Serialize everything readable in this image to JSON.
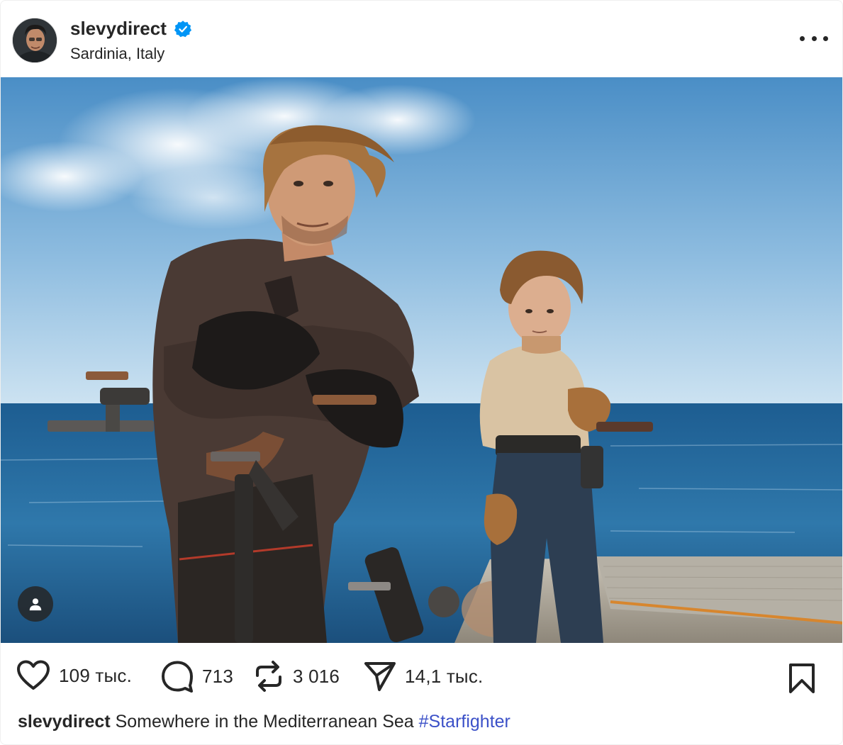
{
  "header": {
    "username": "slevydirect",
    "location": "Sardinia, Italy",
    "icons": {
      "verified": "verified-badge-icon",
      "more": "more-options-icon"
    },
    "accent_color": "#0095f6"
  },
  "photo": {
    "tag_icon": "user-tag-icon"
  },
  "actions": {
    "likes": "109 тыс.",
    "comments": "713",
    "reposts": "3 016",
    "shares": "14,1 тыс.",
    "icons": {
      "like": "heart-icon",
      "comment": "comment-bubble-icon",
      "repost": "repost-arrows-icon",
      "share": "send-paper-plane-icon",
      "save": "bookmark-icon"
    }
  },
  "caption": {
    "username": "slevydirect",
    "text": "Somewhere in the Mediterranean Sea",
    "hashtag": "#Starfighter",
    "hashtag_color": "#3c51c8"
  }
}
